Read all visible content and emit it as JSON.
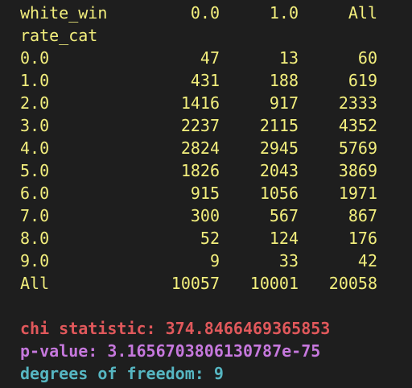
{
  "table": {
    "header": {
      "label": "white_win",
      "cols": [
        "0.0",
        "1.0",
        "All"
      ]
    },
    "index_name": "rate_cat",
    "rows": [
      {
        "label": "0.0",
        "values": [
          "47",
          "13",
          "60"
        ]
      },
      {
        "label": "1.0",
        "values": [
          "431",
          "188",
          "619"
        ]
      },
      {
        "label": "2.0",
        "values": [
          "1416",
          "917",
          "2333"
        ]
      },
      {
        "label": "3.0",
        "values": [
          "2237",
          "2115",
          "4352"
        ]
      },
      {
        "label": "4.0",
        "values": [
          "2824",
          "2945",
          "5769"
        ]
      },
      {
        "label": "5.0",
        "values": [
          "1826",
          "2043",
          "3869"
        ]
      },
      {
        "label": "6.0",
        "values": [
          "915",
          "1056",
          "1971"
        ]
      },
      {
        "label": "7.0",
        "values": [
          "300",
          "567",
          "867"
        ]
      },
      {
        "label": "8.0",
        "values": [
          "52",
          "124",
          "176"
        ]
      },
      {
        "label": "9.0",
        "values": [
          "9",
          "33",
          "42"
        ]
      },
      {
        "label": "All",
        "values": [
          "10057",
          "10001",
          "20058"
        ]
      }
    ]
  },
  "stats": {
    "chi": "chi statistic: 374.8466469365853",
    "pvalue": "p-value: 3.1656703806130787e-75",
    "dof": "degrees of freedom: 9"
  },
  "colors": {
    "background": "#1e1e1e",
    "table_text": "#f3ef7d",
    "chi": "#e0585b",
    "pvalue": "#c678dd",
    "dof": "#56b6c2"
  }
}
